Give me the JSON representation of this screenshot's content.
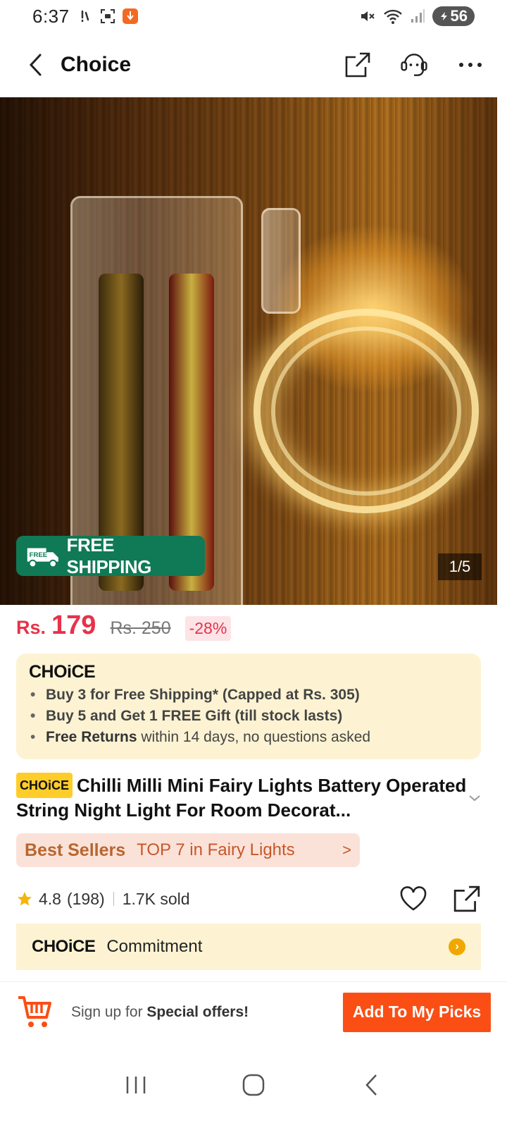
{
  "status_bar": {
    "time": "6:37",
    "battery": "56",
    "icons": [
      "notification-icon",
      "screenshot-icon",
      "app-badge-icon",
      "mute-icon",
      "wifi-icon",
      "signal-icon",
      "battery-icon"
    ]
  },
  "top_bar": {
    "title": "Choice",
    "icons": [
      "back-icon",
      "share-icon",
      "support-agent-icon",
      "more-icon"
    ]
  },
  "hero": {
    "badge": "FREE SHIPPING",
    "badge_icon_text": "FREE",
    "counter": "1/5"
  },
  "price": {
    "currency": "Rs.",
    "current": "179",
    "original": "Rs. 250",
    "discount": "-28%"
  },
  "choice_promo": {
    "logo": "CHOiCE",
    "item1": "Buy 3 for  Free Shipping* (Capped at Rs. 305)",
    "item2": "Buy 5 and Get 1 FREE Gift (till stock lasts)",
    "item3_bold": "Free Returns",
    "item3_rest": " within 14 days, no questions asked"
  },
  "product": {
    "badge": "CHOiCE",
    "title": "Chilli Milli Mini Fairy Lights Battery Operated String Night Light For Room Decorat..."
  },
  "best_sellers": {
    "label": "Best Sellers",
    "rank": "TOP 7 in Fairy Lights",
    "arrow": ">"
  },
  "rating": {
    "score": "4.8",
    "count": "(198)",
    "sold": "1.7K sold"
  },
  "commitment": {
    "logo": "CHOiCE",
    "label": "Commitment"
  },
  "bottom_bar": {
    "signup_prefix": "Sign up for ",
    "signup_bold": "Special offers!",
    "button": "Add To My Picks"
  },
  "colors": {
    "accent_red": "#e8324a",
    "cta_orange": "#fb4e15",
    "choice_yellow": "#fdf3d3",
    "free_ship_green": "#0f7a55"
  }
}
